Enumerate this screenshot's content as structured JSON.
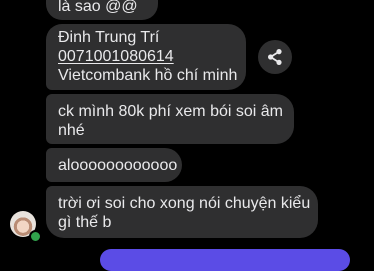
{
  "messages": [
    {
      "lines": [
        "là sao @@"
      ]
    },
    {
      "lines": [
        "Đinh Trung Trí",
        "0071001080614",
        "Vietcombank hồ chí minh"
      ]
    },
    {
      "lines": [
        "ck mình 80k phí xem bói soi âm",
        "nhé"
      ]
    },
    {
      "lines": [
        "aloooooooooooo"
      ]
    },
    {
      "lines": [
        "trời ơi soi cho xong nói chuyện kiểu",
        "gì thế b"
      ]
    }
  ],
  "share_button": {
    "icon": "share-icon"
  },
  "sender": {
    "avatar": "avatar",
    "status": "online",
    "status_color": "#31a24c"
  },
  "theme": {
    "bubble": "#2f2f30",
    "text": "#e9e9eb",
    "background": "#000000",
    "accent": "#5b4ce6"
  }
}
